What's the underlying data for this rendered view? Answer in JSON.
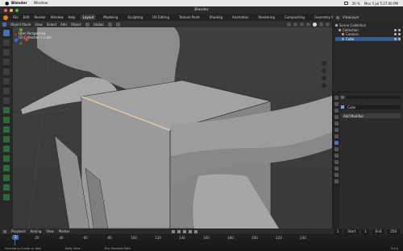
{
  "macos": {
    "app_name": "Blender",
    "menu_window": "Window",
    "clock": "Mon 5 Jul 5:27:00 PM",
    "percent": "20 %"
  },
  "window": {
    "title": "Blender"
  },
  "topbar": {
    "menus": [
      "File",
      "Edit",
      "Render",
      "Window",
      "Help"
    ],
    "tabs": [
      "Layout",
      "Modeling",
      "Sculpting",
      "UV Editing",
      "Texture Paint",
      "Shading",
      "Animation",
      "Rendering",
      "Compositing",
      "Geometry Nodes"
    ],
    "active_tab": "Layout",
    "scene": "Scene",
    "view_layer": "ViewLayer"
  },
  "viewport": {
    "mode": "Object Mode",
    "menus": [
      "View",
      "Select",
      "Add",
      "Object"
    ],
    "transform": "Global",
    "options": "Options",
    "overlay_line1": "User Perspective",
    "overlay_line2": "(1) Collection | Cube"
  },
  "outliner": {
    "rows": [
      {
        "label": "Scene Collection",
        "indent": 0,
        "selected": false
      },
      {
        "label": "Collection",
        "indent": 1,
        "selected": false
      },
      {
        "label": "Camera",
        "indent": 2,
        "selected": false
      },
      {
        "label": "Cube",
        "indent": 2,
        "selected": true
      }
    ]
  },
  "properties": {
    "object_name": "Cube",
    "add_modifier": "Add Modifier"
  },
  "timeline": {
    "menus": [
      "Playback",
      "Keying",
      "View",
      "Marker"
    ],
    "current_frame": "1",
    "start_label": "Start",
    "start": "1",
    "end_label": "End",
    "end": "250",
    "ticks": [
      "0",
      "20",
      "40",
      "60",
      "80",
      "100",
      "120",
      "140",
      "160",
      "180",
      "200",
      "220",
      "240"
    ]
  },
  "status": {
    "item1": "Extrude to Cursor or Add",
    "item2": "Dolly View",
    "item3": "Pick Shortest Path",
    "version": "3.0.0"
  },
  "colors": {
    "accent": "#4772b3",
    "viewport_bg": "#3d3d3d",
    "logo": "#e87d0d"
  }
}
